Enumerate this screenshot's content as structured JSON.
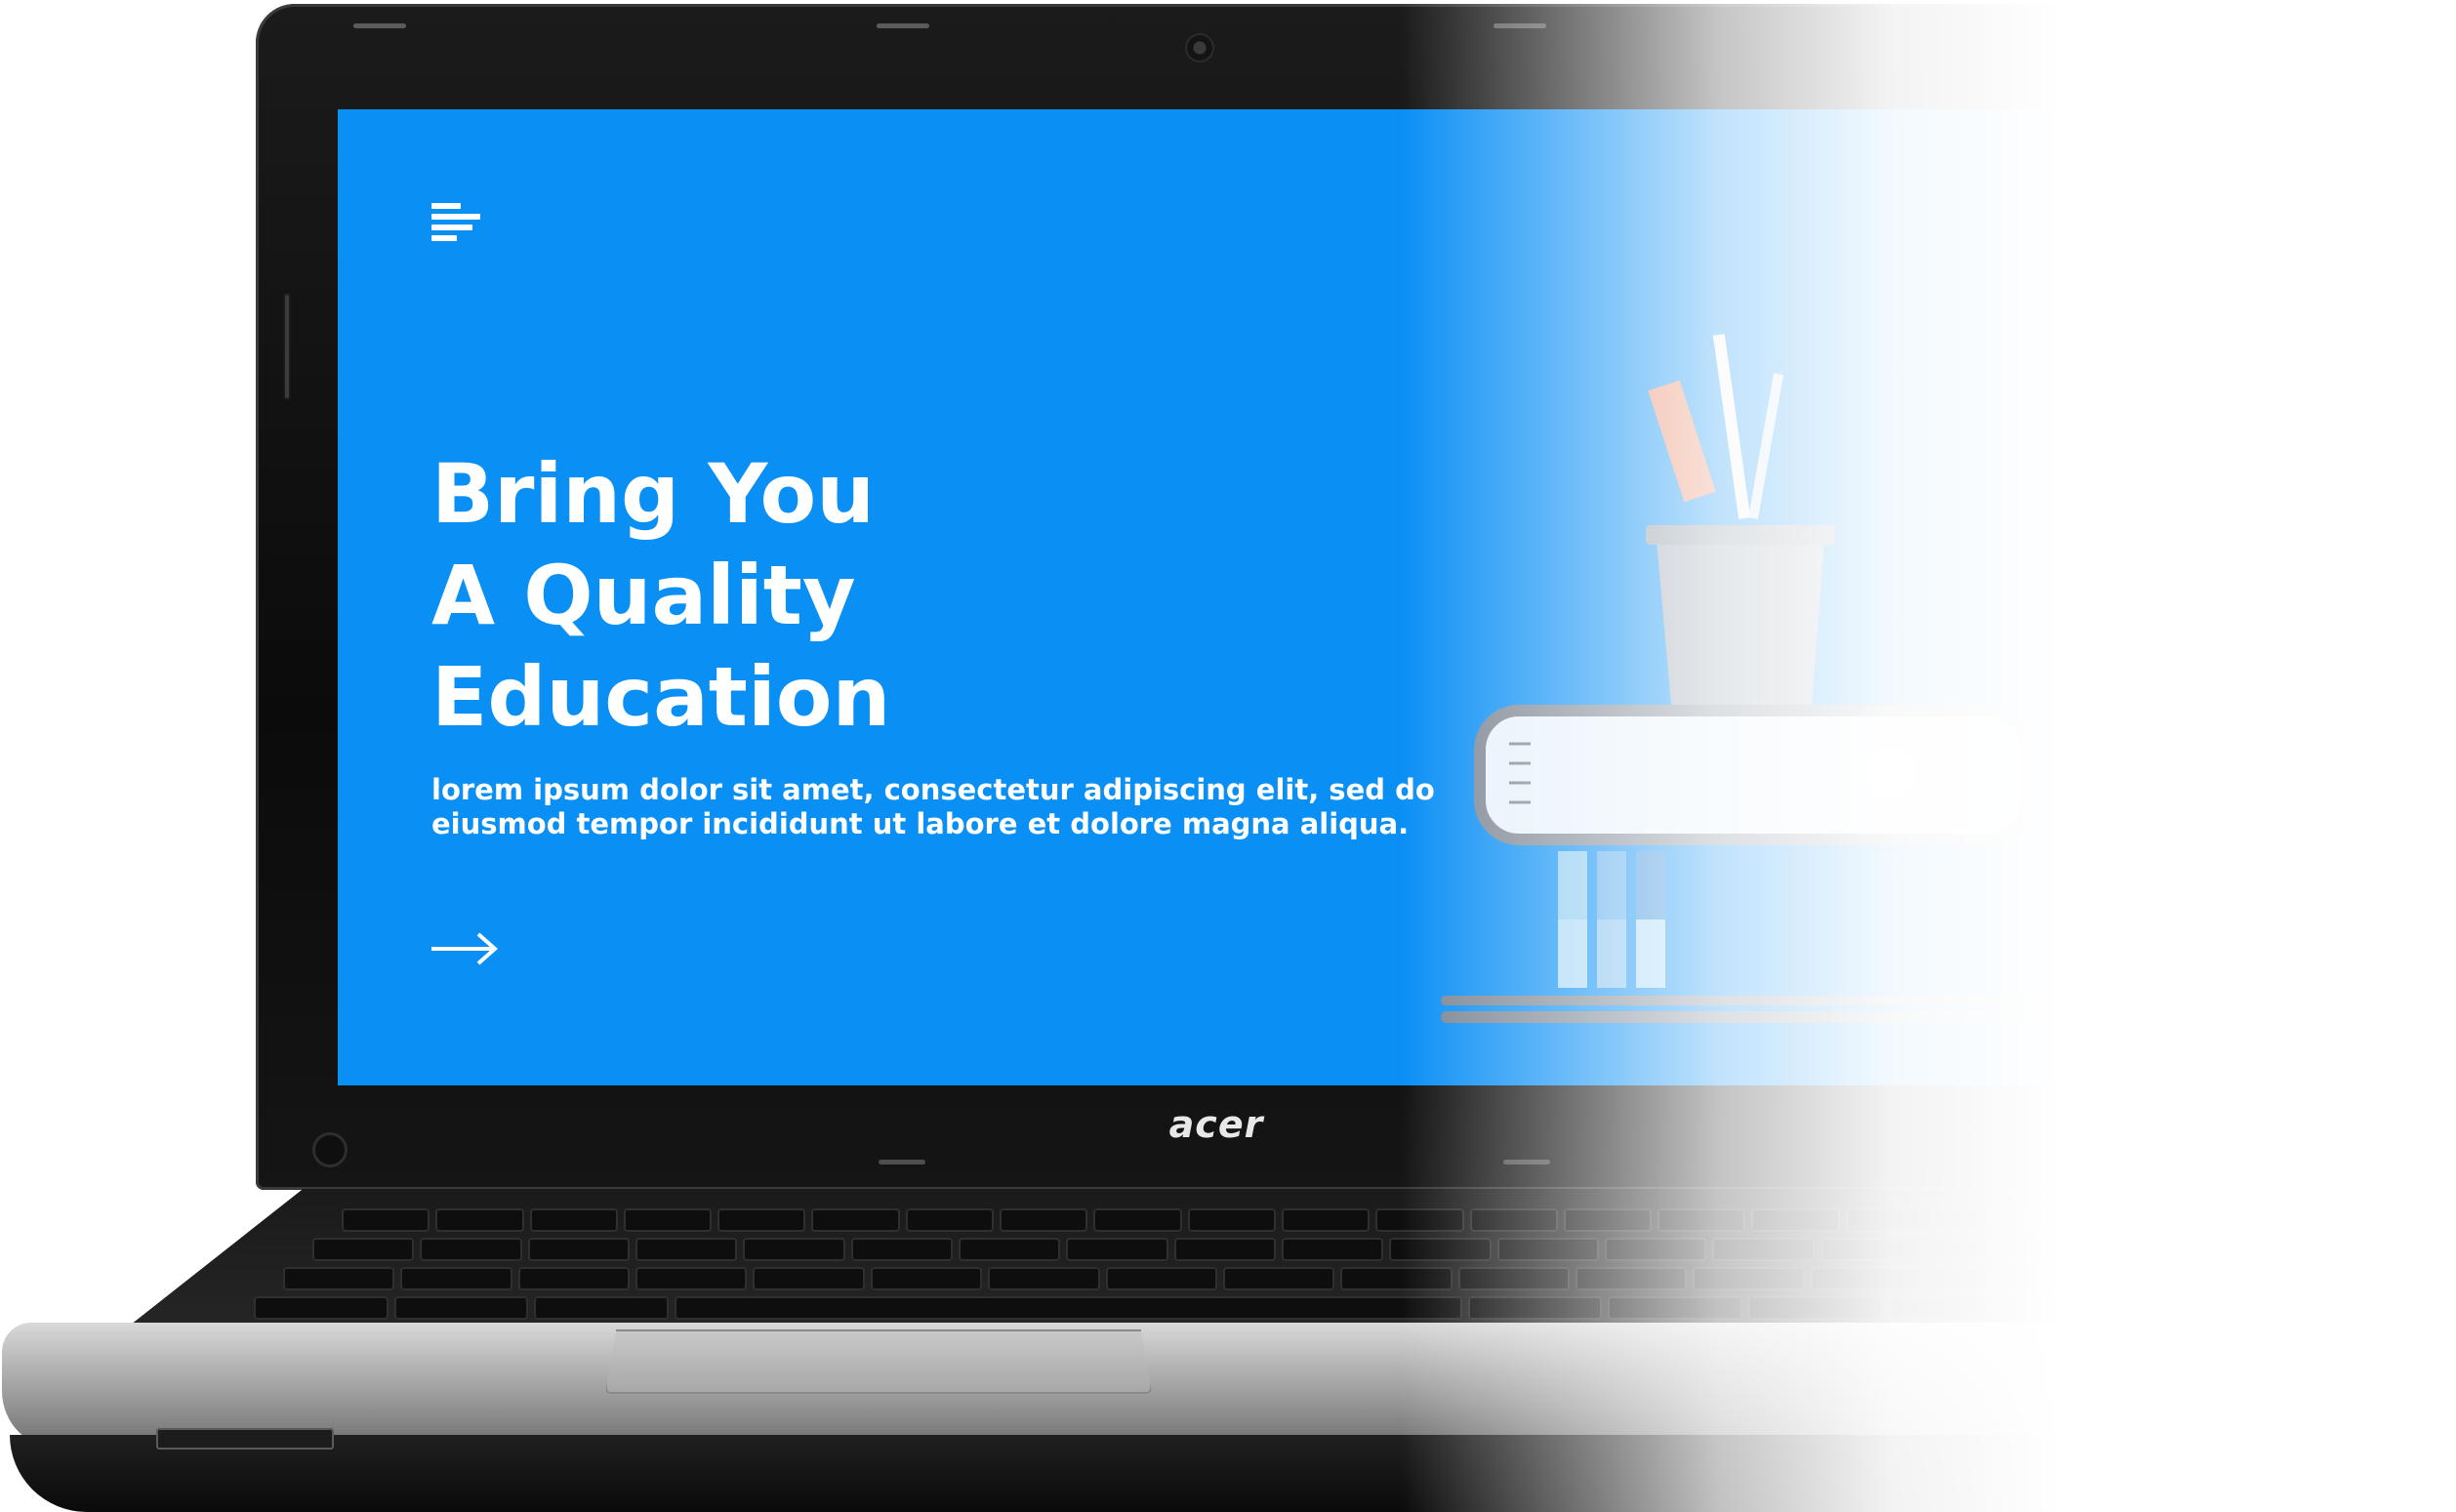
{
  "device": {
    "brand_logo": "acer"
  },
  "screen": {
    "menu_icon": "hamburger-menu-icon",
    "headline_lines": [
      "Bring You",
      "A Quality",
      "Education"
    ],
    "subtext_lines": [
      "lorem ipsum dolor sit amet, consectetur adipiscing elit, sed do",
      "eiusmod tempor incididunt ut labore et dolore magna aliqua."
    ],
    "cta_icon": "arrow-right-icon",
    "illustration_icon": "books-and-pencil-cup-icon",
    "colors": {
      "background": "#0a8ff5",
      "text": "#ffffff"
    }
  }
}
